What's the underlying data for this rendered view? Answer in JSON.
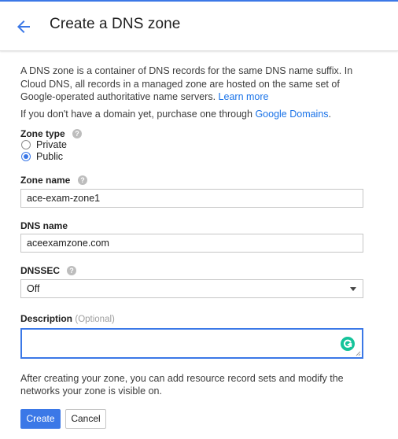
{
  "header": {
    "title": "Create a DNS zone",
    "back_icon": "arrow-left-icon"
  },
  "intro": {
    "text": "A DNS zone is a container of DNS records for the same DNS name suffix. In Cloud DNS, all records in a managed zone are hosted on the same set of Google-operated authoritative name servers.",
    "learn_more": "Learn more"
  },
  "domains_note": {
    "text": "If you don't have a domain yet, purchase one through",
    "link": "Google Domains",
    "suffix": "."
  },
  "zone_type": {
    "label": "Zone type",
    "options": [
      {
        "label": "Private",
        "selected": false
      },
      {
        "label": "Public",
        "selected": true
      }
    ]
  },
  "zone_name": {
    "label": "Zone name",
    "value": "ace-exam-zone1"
  },
  "dns_name": {
    "label": "DNS name",
    "value": "aceexamzone.com"
  },
  "dnssec": {
    "label": "DNSSEC",
    "value": "Off"
  },
  "description": {
    "label": "Description",
    "optional": "(Optional)",
    "value": ""
  },
  "footnote": "After creating your zone, you can add resource record sets and modify the networks your zone is visible on.",
  "actions": {
    "create": "Create",
    "cancel": "Cancel"
  },
  "colors": {
    "accent": "#3b78e7",
    "link": "#1a73e8",
    "grammarly": "#15c39a"
  }
}
